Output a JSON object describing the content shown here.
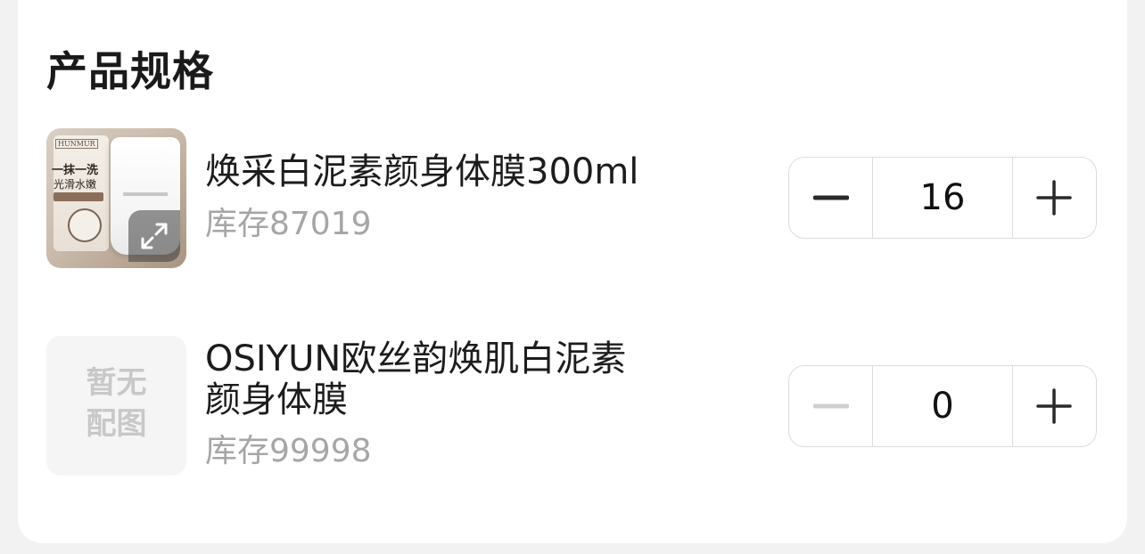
{
  "section": {
    "title": "产品规格"
  },
  "products": [
    {
      "name_line1": "焕采白泥素颜身体膜300ml",
      "name_line2": "",
      "stock": "库存87019",
      "quantity": "16",
      "thumbnail": {
        "brand": "HUNMUR",
        "slogan_line1": "一抹一洗",
        "slogan_line2": "光滑水嫩"
      },
      "minus_enabled": true
    },
    {
      "name_line1": "OSIYUN欧丝韵焕肌白泥素",
      "name_line2": "颜身体膜",
      "stock": "库存99998",
      "quantity": "0",
      "thumbnail": {
        "placeholder_line1": "暂无",
        "placeholder_line2": "配图"
      },
      "minus_enabled": false
    }
  ],
  "icons": {
    "expand": "expand-arrows-icon",
    "minus": "minus-icon",
    "plus": "plus-icon"
  },
  "colors": {
    "minus_active": "#2a2a2a",
    "minus_disabled": "#cfcfcf",
    "stock_text": "#a6a6a6"
  }
}
